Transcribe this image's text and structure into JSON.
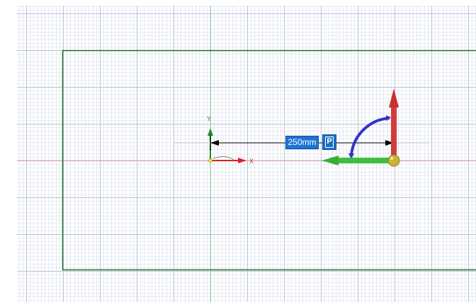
{
  "canvas": {
    "grid_minor_color": "#d6dcea",
    "grid_major_color": "#b9c1d6",
    "rectangle_color": "#1f6e2a",
    "x_axis_color": "#e06060",
    "y_axis_color": "#7fc28a"
  },
  "origin_gizmo": {
    "x_label": "X",
    "y_label": "Y",
    "x_color": "#e02020",
    "y_color": "#1c8c2a"
  },
  "dimension": {
    "value": "250mm",
    "pin_label": "P",
    "box_color": "#1e73d4"
  },
  "move_gizmo": {
    "x_arrow_color": "#3fbf3f",
    "y_arrow_color": "#d23c3c",
    "rotate_arc_color": "#3434c8",
    "center_color": "#c6b43a",
    "icons": [
      "green-x-arrow-icon",
      "red-y-arrow-icon",
      "blue-rotate-arc-icon",
      "gizmo-center-handle-icon"
    ]
  }
}
